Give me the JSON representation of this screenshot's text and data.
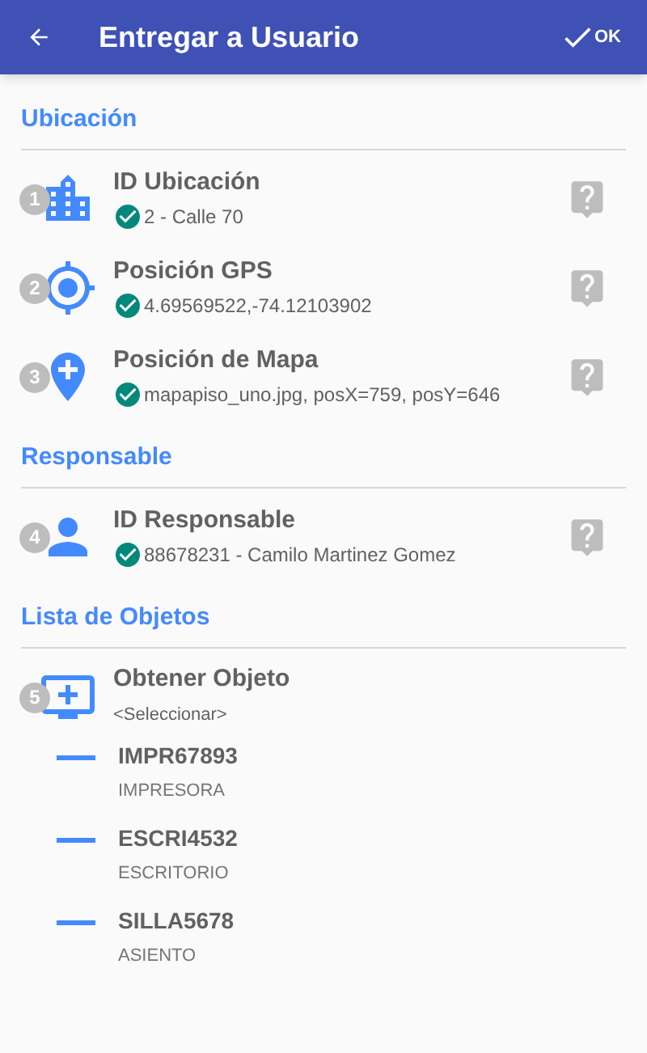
{
  "app_bar": {
    "title": "Entregar a Usuario",
    "action": "OK"
  },
  "sections": [
    {
      "title": "Ubicación",
      "fields": [
        {
          "number": "1",
          "kind": "building",
          "label": "ID Ubicación",
          "value": "2 - Calle 70",
          "verified": true,
          "help": true
        },
        {
          "number": "2",
          "kind": "gps",
          "label": "Posición GPS",
          "value": "4.69569522,-74.12103902",
          "verified": true,
          "help": true
        },
        {
          "number": "3",
          "kind": "map",
          "label": "Posición de Mapa",
          "value": "mapapiso_uno.jpg, posX=759, posY=646",
          "verified": true,
          "help": true
        }
      ]
    },
    {
      "title": "Responsable",
      "fields": [
        {
          "number": "4",
          "kind": "person",
          "label": "ID Responsable",
          "value": "88678231 - Camilo Martinez Gomez",
          "verified": true,
          "help": true
        }
      ]
    },
    {
      "title": "Lista de Objetos",
      "fields": [
        {
          "number": "5",
          "kind": "add_object",
          "label": "Obtener Objeto",
          "value": "<Seleccionar>",
          "verified": false,
          "help": false
        }
      ],
      "objects": [
        {
          "code": "IMPR67893",
          "type": "IMPRESORA"
        },
        {
          "code": "ESCRI4532",
          "type": "ESCRITORIO"
        },
        {
          "code": "SILLA5678",
          "type": "ASIENTO"
        }
      ]
    }
  ]
}
